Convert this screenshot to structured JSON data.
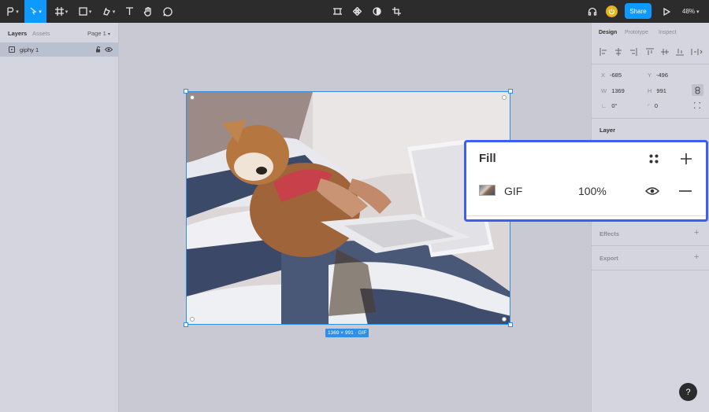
{
  "toolbar": {
    "share_label": "Share",
    "zoom_label": "48%",
    "icons": [
      "main-menu-icon",
      "move-tool-icon",
      "frame-tool-icon",
      "shape-tool-icon",
      "pen-tool-icon",
      "text-tool-icon",
      "hand-tool-icon",
      "comment-tool-icon",
      "edit-object-icon",
      "component-icon",
      "mask-icon",
      "crop-icon",
      "headphones-icon",
      "present-icon"
    ]
  },
  "left_panel": {
    "tabs": [
      "Layers",
      "Assets"
    ],
    "page_label": "Page 1",
    "layer_name": "giphy 1"
  },
  "canvas": {
    "size_label": "1369 × 991 · GIF"
  },
  "right_panel": {
    "tabs": [
      "Design",
      "Prototype",
      "Inspect"
    ],
    "props": {
      "x_label": "X",
      "x": "-685",
      "y_label": "Y",
      "y": "-496",
      "w_label": "W",
      "w": "1369",
      "h_label": "H",
      "h": "991",
      "rotation": "0°",
      "radius": "0"
    },
    "layer_title": "Layer",
    "effects_title": "Effects",
    "export_title": "Export"
  },
  "fill_popup": {
    "title": "Fill",
    "type": "GIF",
    "opacity": "100%"
  },
  "help_label": "?",
  "colors": {
    "accent": "#0d99ff",
    "popup_border": "#3d5ff0",
    "toolbar_bg": "#2c2c2c",
    "canvas_bg": "#c8c9d2"
  }
}
